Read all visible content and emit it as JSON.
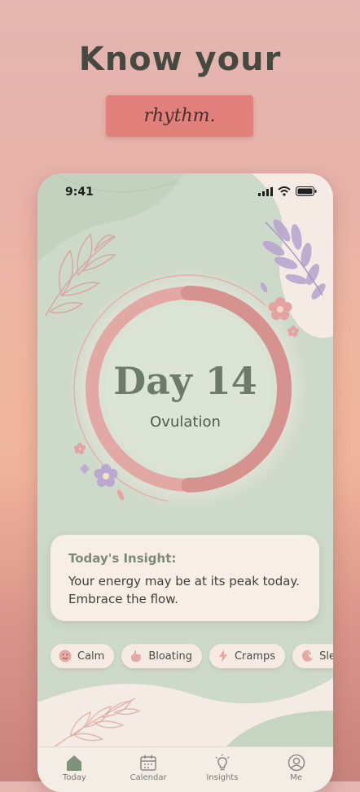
{
  "header": {
    "headline": "Know your",
    "tagline": "rhythm."
  },
  "status_bar": {
    "time": "9:41",
    "icons": [
      "signal-icon",
      "wifi-icon",
      "battery-icon"
    ]
  },
  "cycle": {
    "day_label": "Day 14",
    "phase": "Ovulation",
    "progress_fraction": 0.5
  },
  "insight": {
    "title": "Today's Insight:",
    "body": "Your energy may be at its peak today. Embrace the flow."
  },
  "symptoms": [
    {
      "label": "Calm",
      "icon": "smile-icon"
    },
    {
      "label": "Bloating",
      "icon": "stomach-icon"
    },
    {
      "label": "Cramps",
      "icon": "lightning-icon"
    },
    {
      "label": "Sleep",
      "icon": "moon-icon"
    }
  ],
  "tabs": [
    {
      "label": "Today",
      "icon": "home-icon",
      "active": true
    },
    {
      "label": "Calendar",
      "icon": "calendar-icon",
      "active": false
    },
    {
      "label": "Insights",
      "icon": "lightbulb-icon",
      "active": false
    },
    {
      "label": "Me",
      "icon": "profile-icon",
      "active": false
    }
  ],
  "colors": {
    "accent": "#e2807c",
    "ring": "#e3a5a2",
    "phone_bg": "#cdd9c9",
    "card_bg": "#f7eee5",
    "headline": "#46493f",
    "day_text": "#6c7b6a"
  }
}
